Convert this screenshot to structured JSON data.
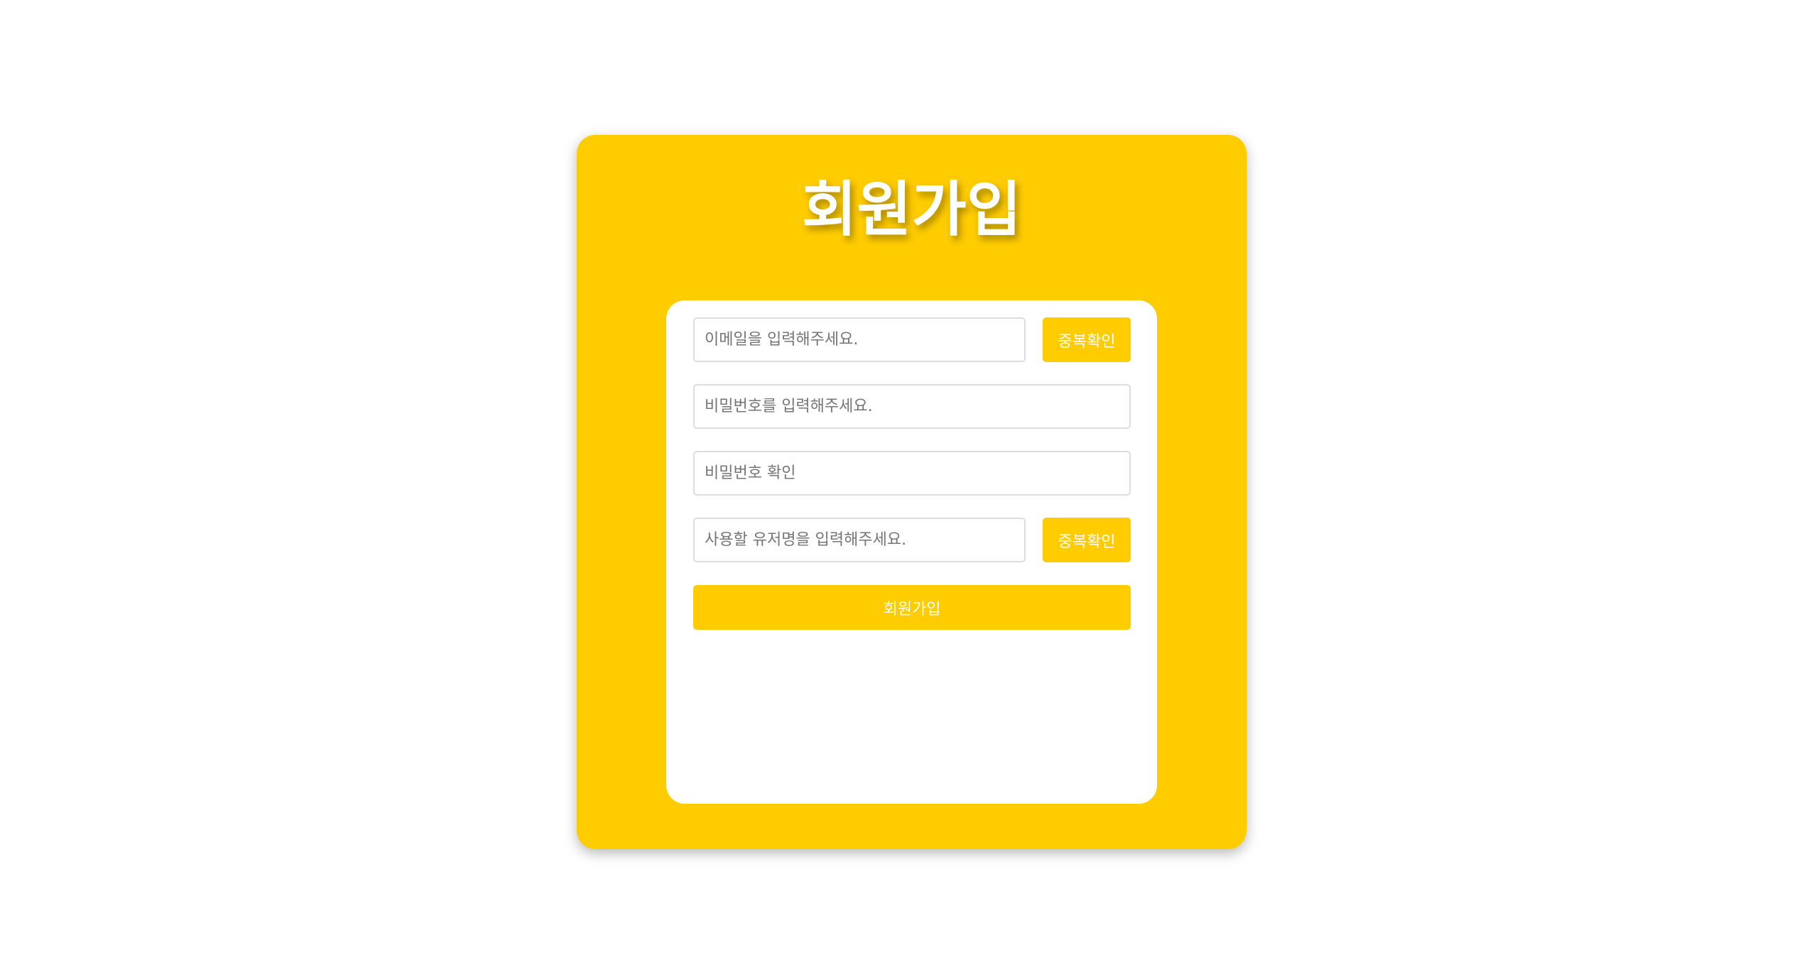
{
  "page": {
    "title": "회원가입"
  },
  "form": {
    "email": {
      "placeholder": "이메일을 입력해주세요.",
      "value": "",
      "check_label": "중복확인"
    },
    "password": {
      "placeholder": "비밀번호를 입력해주세요.",
      "value": ""
    },
    "password_confirm": {
      "placeholder": "비밀번호 확인",
      "value": ""
    },
    "username": {
      "placeholder": "사용할 유저명을 입력해주세요.",
      "value": "",
      "check_label": "중복확인"
    },
    "submit_label": "회원가입"
  },
  "colors": {
    "accent": "#FFCC00",
    "panel": "#FFFFFF",
    "text_on_accent": "#FFFFFF"
  }
}
